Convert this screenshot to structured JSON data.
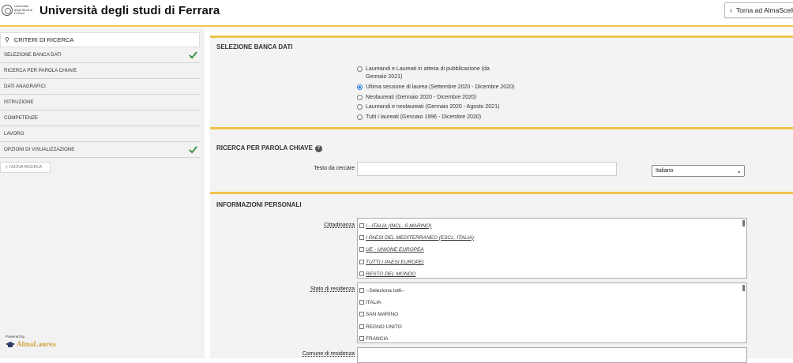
{
  "header": {
    "title": "Università degli studi di Ferrara",
    "logo_text": "Università degli Studi di Ferrara",
    "back_label": "Torna ad AlmaSceltaa"
  },
  "sidebar": {
    "search_label": "CRITERI DI RICERCA",
    "items": [
      {
        "label": "SELEZIONE BANCA DATI",
        "checked": true
      },
      {
        "label": "RICERCA PER PAROLA CHIAVE",
        "checked": false
      },
      {
        "label": "DATI ANAGRAFICI",
        "checked": false
      },
      {
        "label": "ISTRUZIONE",
        "checked": false
      },
      {
        "label": "COMPETENZE",
        "checked": false
      },
      {
        "label": "LAVORO",
        "checked": false
      },
      {
        "label": "OPZIONI DI VISUALIZZAZIONE",
        "checked": true
      }
    ],
    "new_search": "NUOVA RICERCA",
    "powered_by": "Powered By",
    "brand": "AlmaLaurea"
  },
  "sections": {
    "database": {
      "title": "SELEZIONE BANCA DATI",
      "options": [
        {
          "label": "Laureandi e Laureati in attesa di pubblicazione (da Gennaio 2021)",
          "selected": false
        },
        {
          "label": "Ultima sessione di laurea (Settembre 2020 - Dicembre 2020)",
          "selected": true
        },
        {
          "label": "Neolaureati (Gennaio 2020 - Dicembre 2020)",
          "selected": false
        },
        {
          "label": "Laureandi e neolaureati (Gennaio 2020 - Agosto 2021)",
          "selected": false
        },
        {
          "label": "Tutti i laureati (Gennaio 1996 - Dicembre 2020)",
          "selected": false
        }
      ]
    },
    "keyword": {
      "title": "RICERCA PER PAROLA CHIAVE",
      "help": "?",
      "text_label": "Testo da cercare",
      "text_value": "",
      "language": "Italiano"
    },
    "personal": {
      "title": "INFORMAZIONI PERSONALI",
      "citizenship_label": "Cittadinanza",
      "citizenship_options": [
        "I - ITALIA (INCL. S.MARINO)",
        "I PAESI DEL MEDITERRANEO (ESCL. ITALIA)",
        "UE - UNIONE EUROPEA",
        "TUTTI I PAESI EUROPEI",
        "RESTO DEL MONDO"
      ],
      "residence_state_label": "Stato di residenza",
      "residence_state_options": [
        "--Seleziona tutti--",
        "ITALIA",
        "SAN MARINO",
        "REGNO UNITO",
        "FRANCIA"
      ],
      "residence_city_label": "Comune di residenza"
    }
  },
  "colors": {
    "accent": "#f0c24b",
    "check": "#2e8b3e",
    "radio": "#1e73d8"
  }
}
